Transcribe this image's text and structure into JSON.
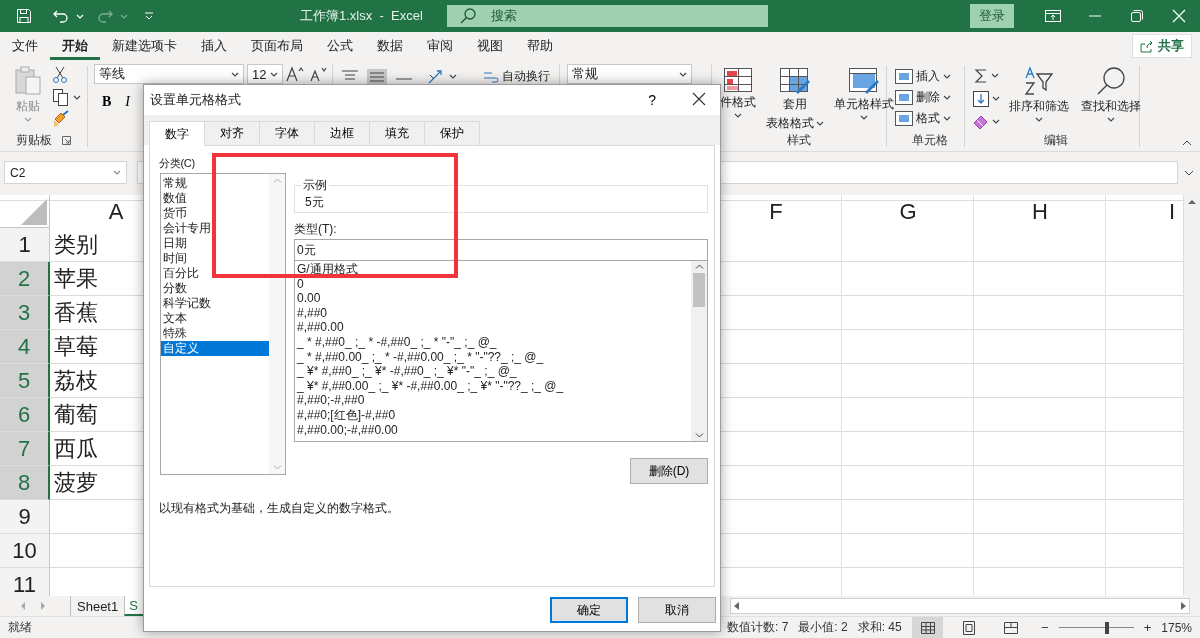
{
  "title_bar": {
    "title": "工作簿1.xlsx  -  Excel",
    "search": {
      "placeholder": "搜索"
    },
    "sign_in": "登录"
  },
  "ribbon_tabs": [
    {
      "label": "文件",
      "selected": false
    },
    {
      "label": "开始",
      "selected": true
    },
    {
      "label": "新建选项卡",
      "selected": false
    },
    {
      "label": "插入",
      "selected": false
    },
    {
      "label": "页面布局",
      "selected": false
    },
    {
      "label": "公式",
      "selected": false
    },
    {
      "label": "数据",
      "selected": false
    },
    {
      "label": "审阅",
      "selected": false
    },
    {
      "label": "视图",
      "selected": false
    },
    {
      "label": "帮助",
      "selected": false
    }
  ],
  "share": "共享",
  "ribbon": {
    "clipboard": {
      "paste": "粘贴",
      "group": "剪贴板"
    },
    "font": {
      "name": "等线",
      "size": "12",
      "bold": "B",
      "italic": "I"
    },
    "alignment": {
      "wrap": "自动换行"
    },
    "number": {
      "format": "常规"
    },
    "styles": {
      "conditional": "件格式",
      "table": [
        "套用",
        "表格格式"
      ],
      "cell_styles": "单元格样式",
      "group": "样式"
    },
    "cells": {
      "items": [
        "插入",
        "删除",
        "格式"
      ],
      "group": "单元格"
    },
    "editing": {
      "sort": "排序和筛选",
      "find": "查找和选择",
      "group": "编辑"
    }
  },
  "name_box": "C2",
  "columns": [
    "A",
    "F",
    "G",
    "H",
    "I"
  ],
  "rows": [
    {
      "number": "1",
      "a": "类别",
      "selected": false
    },
    {
      "number": "2",
      "a": "苹果",
      "selected": true
    },
    {
      "number": "3",
      "a": "香蕉",
      "selected": true
    },
    {
      "number": "4",
      "a": "草莓",
      "selected": true
    },
    {
      "number": "5",
      "a": "荔枝",
      "selected": true
    },
    {
      "number": "6",
      "a": "葡萄",
      "selected": true
    },
    {
      "number": "7",
      "a": "西瓜",
      "selected": true
    },
    {
      "number": "8",
      "a": "菠萝",
      "selected": true
    },
    {
      "number": "9",
      "selected": false
    },
    {
      "number": "10",
      "selected": false
    },
    {
      "number": "11",
      "selected": false
    }
  ],
  "sheet_tabs": [
    {
      "label": "Sheet1",
      "selected": false
    },
    {
      "label": "S",
      "selected": true
    }
  ],
  "status_bar": {
    "ready": "就绪",
    "stats": [
      "数值计数: 7",
      "最小值: 2",
      "求和: 45"
    ],
    "views": [
      {
        "kind": "normal",
        "selected": true
      },
      {
        "kind": "page_layout",
        "selected": false
      },
      {
        "kind": "page_break",
        "selected": false
      }
    ],
    "zoom": {
      "out": "−",
      "level": 0.64,
      "in": "+",
      "reading": "175%"
    }
  },
  "dialog": {
    "title": "设置单元格格式",
    "help": "?",
    "tabs": [
      {
        "label": "数字",
        "selected": true
      },
      {
        "label": "对齐",
        "selected": false
      },
      {
        "label": "字体",
        "selected": false
      },
      {
        "label": "边框",
        "selected": false
      },
      {
        "label": "填充",
        "selected": false
      },
      {
        "label": "保护",
        "selected": false
      }
    ],
    "category_label": "分类(C)",
    "categories": [
      {
        "label": "常规",
        "selected": false
      },
      {
        "label": "数值",
        "selected": false
      },
      {
        "label": "货币",
        "selected": false
      },
      {
        "label": "会计专用",
        "selected": false
      },
      {
        "label": "日期",
        "selected": false
      },
      {
        "label": "时间",
        "selected": false
      },
      {
        "label": "百分比",
        "selected": false
      },
      {
        "label": "分数",
        "selected": false
      },
      {
        "label": "科学记数",
        "selected": false
      },
      {
        "label": "文本",
        "selected": false
      },
      {
        "label": "特殊",
        "selected": false
      },
      {
        "label": "自定义",
        "selected": true
      }
    ],
    "sample": {
      "label": "示例",
      "value": "5元"
    },
    "type_label": "类型(T):",
    "type_value": "0元",
    "formats": [
      "G/通用格式",
      "0",
      "0.00",
      "#,##0",
      "#,##0.00",
      "_ * #,##0_ ;_ * -#,##0_ ;_ * \"-\"_ ;_ @_",
      "_ * #,##0.00_ ;_ * -#,##0.00_ ;_ * \"-\"??_ ;_ @_",
      "_ ¥* #,##0_ ;_ ¥* -#,##0_ ;_ ¥* \"-\"_ ;_ @_",
      "_ ¥* #,##0.00_ ;_ ¥* -#,##0.00_ ;_ ¥* \"-\"??_ ;_ @_",
      "#,##0;-#,##0",
      "#,##0;[红色]-#,##0",
      "#,##0.00;-#,##0.00"
    ],
    "delete": "删除(D)",
    "description": "以现有格式为基础，生成自定义的数字格式。",
    "ok": "确定",
    "cancel": "取消"
  }
}
